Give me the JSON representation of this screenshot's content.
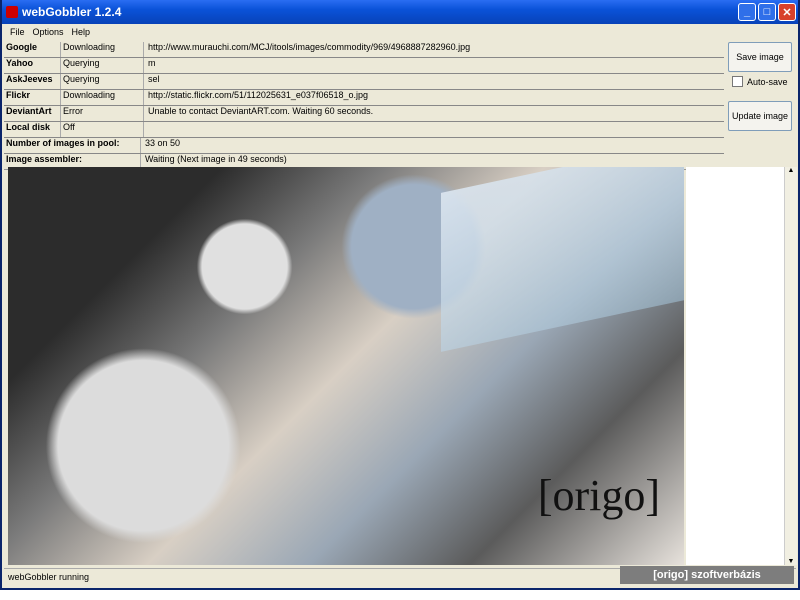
{
  "window": {
    "title": "webGobbler 1.2.4",
    "controls": [
      "_",
      "□",
      "✕"
    ]
  },
  "menu": [
    "File",
    "Options",
    "Help"
  ],
  "sources": [
    {
      "name": "Google",
      "status": "Downloading",
      "detail": "http://www.murauchi.com/MCJ/itools/images/commodity/969/4968887282960.jpg"
    },
    {
      "name": "Yahoo",
      "status": "Querying",
      "detail": "m"
    },
    {
      "name": "AskJeeves",
      "status": "Querying",
      "detail": "sel"
    },
    {
      "name": "Flickr",
      "status": "Downloading",
      "detail": "http://static.flickr.com/51/112025631_e037f06518_o.jpg"
    },
    {
      "name": "DeviantArt",
      "status": "Error",
      "detail": "Unable to contact DeviantART.com. Waiting 60 seconds."
    },
    {
      "name": "Local disk",
      "status": "Off",
      "detail": ""
    }
  ],
  "summary": [
    {
      "name": "Number of images in pool:",
      "detail": "33 on 50"
    },
    {
      "name": "Image assembler:",
      "detail": "Waiting (Next image in 49 seconds)"
    }
  ],
  "buttons": {
    "save": "Save image",
    "update": "Update image",
    "autosave": "Auto-save"
  },
  "canvas": {
    "watermark": "[origo]"
  },
  "scrollbar": {
    "up": "▲",
    "down": "▼"
  },
  "status": "webGobbler running",
  "logo": "[origo] szoftverbázis"
}
